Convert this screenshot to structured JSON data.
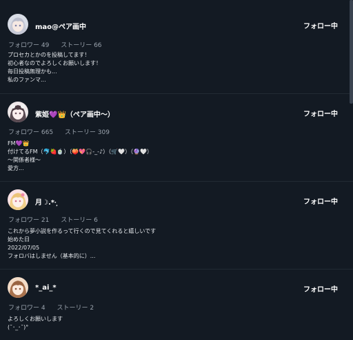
{
  "users": [
    {
      "name": "mao@ペア画中",
      "follow_label": "フォロー中",
      "followers_label": "フォロワー 49",
      "stories_label": "ストーリー 66",
      "bio": [
        "プロセカとかのを投稿してます！",
        "初心者なのでよろしくお願いします！",
        "毎日投稿無理かも...",
        "私のファンマ..."
      ],
      "avatar_icon": "avatar-silver-hair-girl"
    },
    {
      "name": "紫姫💜👑（ペア画中〜）",
      "follow_label": "フォロー中",
      "followers_label": "フォロワー 665",
      "stories_label": "ストーリー 309",
      "bio": [
        "FM💜👑",
        "付けてるFM（🐬🍓🍵）（🍑💖🎧-_-♪）（🛒🤍）（🔮🤍）",
        "〜関係者様〜",
        "愛方..."
      ],
      "avatar_icon": "avatar-dark-hair-girl"
    },
    {
      "name": "月☽.*·̩͙",
      "follow_label": "フォロー中",
      "followers_label": "フォロワー 21",
      "stories_label": "ストーリー 6",
      "bio": [
        "これから夢小説を作るって行くので見てくれると嬉しいです",
        "始めた日",
        "2022/07/05",
        "フォロバはしません（基本的に）..."
      ],
      "avatar_icon": "avatar-blonde-girl"
    },
    {
      "name": "*_ai_*",
      "follow_label": "フォロー中",
      "followers_label": "フォロワー 4",
      "stories_label": "ストーリー 2",
      "bio": [
        "よろしくお願いします",
        "(˘･_･˘)°"
      ],
      "avatar_icon": "avatar-brown-hair-girl"
    }
  ]
}
